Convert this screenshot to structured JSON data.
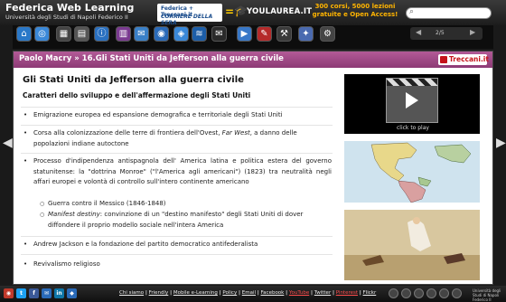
{
  "header": {
    "title": "Federica Web Learning",
    "subtitle": "Università degli Studi di Napoli Federico II",
    "partner_line1": "Federica + Treccani.it",
    "partner_line2": "CORRIERE DELLA SERA",
    "equals": "=",
    "partner_youlaurea": "YOULAUREA.IT",
    "promo_line1": "300 corsi, 5000 lezioni",
    "promo_line2": "gratuite e Open Access!",
    "search_placeholder": ""
  },
  "toolbar": {
    "icons": [
      "home-icon",
      "course-icon",
      "grid-icon",
      "docs-icon",
      "info-icon",
      "books-icon",
      "chat-icon",
      "podcast-icon",
      "lessons-icon",
      "rss-icon",
      "mail-icon",
      "video-icon",
      "edit-icon",
      "tools-icon",
      "network-icon"
    ],
    "pager_text": "2/5"
  },
  "breadcrumb": {
    "text": "Paolo Macry » 16.Gli Stati Uniti da Jefferson alla guerra civile",
    "badge": "Treccani.it"
  },
  "lesson": {
    "title": "Gli Stati Uniti da Jefferson alla guerra civile",
    "subtitle": "Caratteri dello sviluppo e dell'affermazione degli Stati Uniti",
    "bullet1": "Emigrazione europea ed espansione demografica e territoriale degli Stati Uniti",
    "bullet2_a": "Corsa alla colonizzazione delle terre di frontiera dell'Ovest, ",
    "bullet2_em": "Far West",
    "bullet2_b": ", a danno delle popolazioni indiane autoctone",
    "bullet3": "Processo d'indipendenza antispagnola dell' America latina e politica estera del governo statunitense: la \"dottrina Monroe\" (\"l'America agli americani\") (1823) tra neutralità negli affari europei e volontà di controllo sull'intero continente americano",
    "sub1": "Guerra contro il Messico (1846-1848)",
    "sub2_em": "Manifest destiny",
    "sub2_b": ": convinzione di un \"destino manifesto\" degli Stati Uniti di dover diffondere il proprio modello sociale nell'intera America",
    "bullet4": "Andrew Jackson e la fondazione del partito democratico antifederalista",
    "bullet5": "Revivalismo religioso"
  },
  "side": {
    "video_label": "click to play"
  },
  "footer": {
    "links": [
      "Chi siamo",
      "Friendly",
      "Mobile e-Learning",
      "Policy",
      "Email",
      "Facebook",
      "YouTube",
      "Twitter",
      "Pinterest",
      "Flickr"
    ],
    "sep": "|",
    "brand": "Università degli Studi di Napoli Federico II"
  },
  "colors": {
    "crumb": "#9e4786",
    "promo": "#ffb400",
    "treccani": "#c4121a"
  }
}
